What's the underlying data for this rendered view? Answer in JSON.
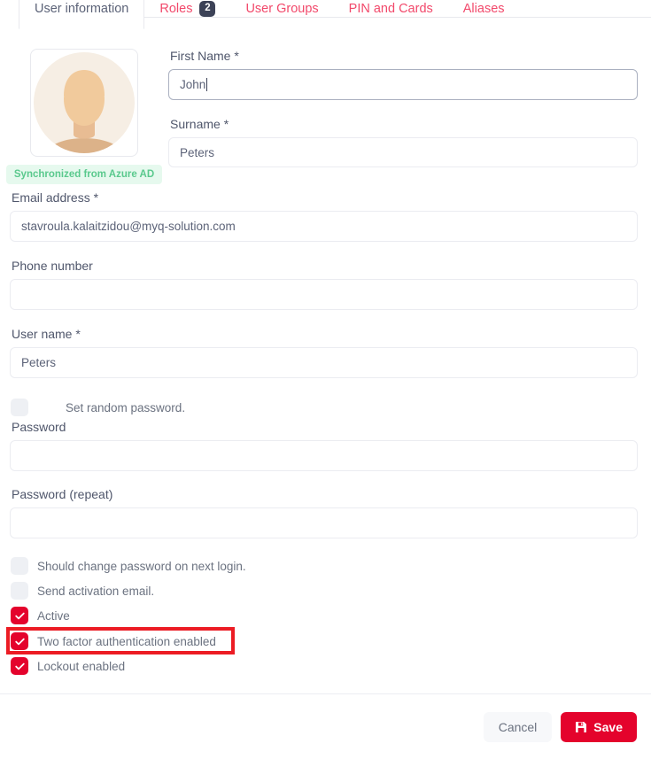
{
  "tabs": [
    {
      "label": "User information",
      "active": true,
      "badge": null
    },
    {
      "label": "Roles",
      "active": false,
      "badge": "2"
    },
    {
      "label": "User Groups",
      "active": false,
      "badge": null
    },
    {
      "label": "PIN and Cards",
      "active": false,
      "badge": null
    },
    {
      "label": "Aliases",
      "active": false,
      "badge": null
    }
  ],
  "avatar": {
    "icon": "default-user-avatar",
    "sync_badge": "Synchronized from Azure AD",
    "badge_bg": "#e6f9ee",
    "badge_color": "#5ac98d"
  },
  "fields": {
    "first_name": {
      "label": "First Name *",
      "value": "John",
      "focused": true
    },
    "surname": {
      "label": "Surname *",
      "value": "Peters",
      "focused": false
    },
    "email": {
      "label": "Email address *",
      "value": "stavroula.kalaitzidou@myq-solution.com",
      "focused": false
    },
    "phone": {
      "label": "Phone number",
      "value": "",
      "focused": false
    },
    "username": {
      "label": "User name *",
      "value": "Peters",
      "focused": false
    },
    "password": {
      "label": "Password",
      "value": "",
      "focused": false
    },
    "password_repeat": {
      "label": "Password (repeat)",
      "value": "",
      "focused": false
    }
  },
  "checkboxes": {
    "set_random_password": {
      "label": "Set random password.",
      "checked": false
    },
    "should_change_password": {
      "label": "Should change password on next login.",
      "checked": false
    },
    "send_activation_email": {
      "label": "Send activation email.",
      "checked": false
    },
    "active": {
      "label": "Active",
      "checked": true
    },
    "two_factor": {
      "label": "Two factor authentication enabled",
      "checked": true
    },
    "lockout": {
      "label": "Lockout enabled",
      "checked": true
    }
  },
  "annotation": {
    "target": "two-factor-authentication-checkbox-row",
    "color": "#ec1c24"
  },
  "footer": {
    "cancel_label": "Cancel",
    "save_label": "Save",
    "save_icon": "floppy-disk-save-icon"
  },
  "colors": {
    "accent_red": "#e4032c",
    "tab_red": "#f2496b",
    "badge_navy": "#3c4257",
    "label_gray": "#4f566b"
  }
}
